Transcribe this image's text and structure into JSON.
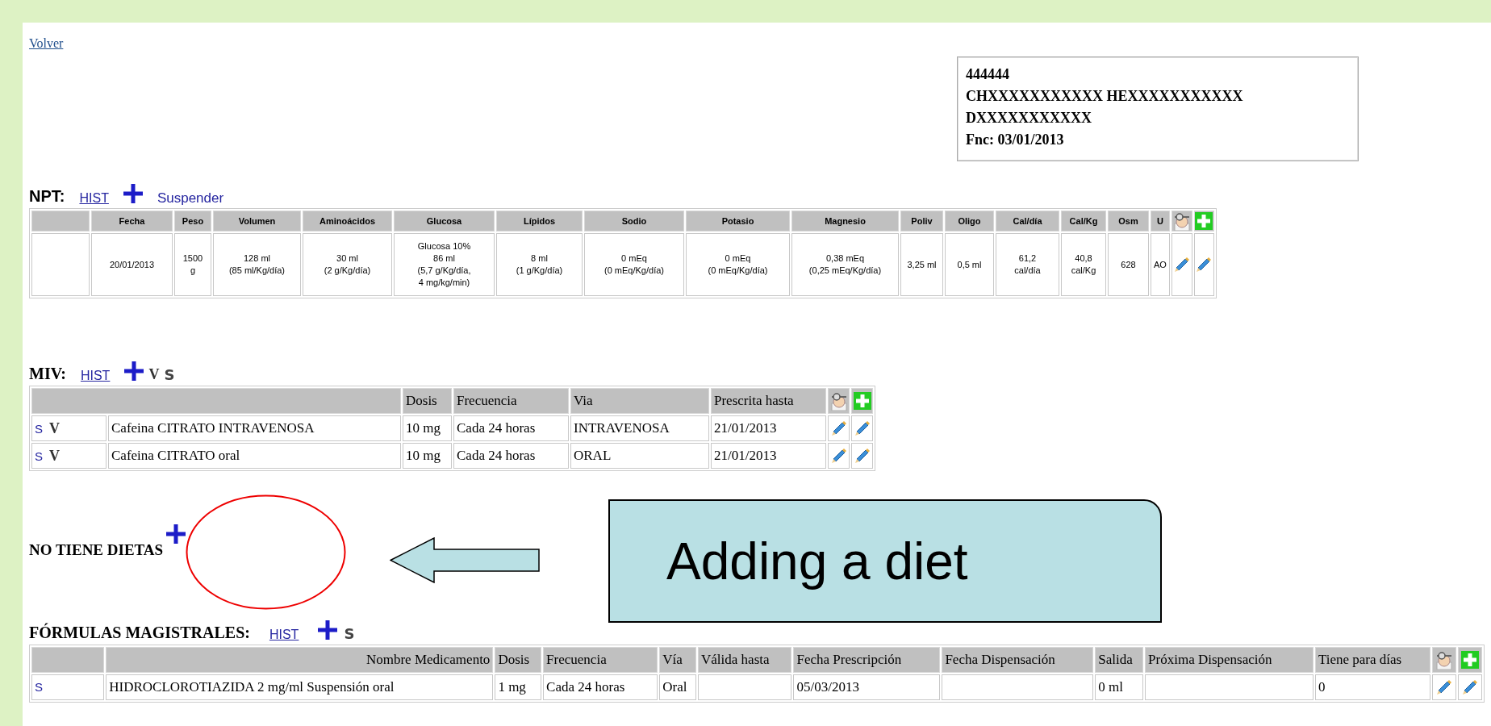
{
  "back_link": "Volver",
  "patient": {
    "lines": [
      "444444",
      "CHXXXXXXXXXXX HEXXXXXXXXXXX",
      "DXXXXXXXXXXX",
      "Fnc: 03/01/2013"
    ]
  },
  "npt": {
    "title": "NPT:",
    "hist": "HIST",
    "suspend": "Suspender",
    "columns": [
      "Fecha",
      "Peso",
      "Volumen",
      "Aminoácidos",
      "Glucosa",
      "Lípidos",
      "Sodio",
      "Potasio",
      "Magnesio",
      "Poliv",
      "Oligo",
      "Cal/día",
      "Cal/Kg",
      "Osm",
      "U"
    ],
    "rows": [
      {
        "cells": [
          "20/01/2013",
          "1500\ng",
          "128 ml\n(85 ml/Kg/día)",
          "30 ml\n(2 g/Kg/día)",
          "Glucosa 10%\n86 ml\n(5,7 g/Kg/día,\n4 mg/kg/min)",
          "8 ml\n(1 g/Kg/día)",
          "0 mEq\n(0 mEq/Kg/día)",
          "0 mEq\n(0 mEq/Kg/día)",
          "0,38 mEq\n(0,25 mEq/Kg/día)",
          "3,25 ml",
          "0,5 ml",
          "61,2\ncal/día",
          "40,8\ncal/Kg",
          "628",
          "AO"
        ]
      }
    ]
  },
  "miv": {
    "title": "MIV:",
    "hist": "HIST",
    "v_action": "V",
    "s_action": "S",
    "columns": [
      "",
      "Dosis",
      "Frecuencia",
      "Via",
      "Prescrita hasta"
    ],
    "rows": [
      {
        "s": "S",
        "v": "V",
        "cells": [
          "Cafeina CITRATO INTRAVENOSA",
          "10 mg",
          "Cada 24 horas",
          "INTRAVENOSA",
          "21/01/2013"
        ]
      },
      {
        "s": "S",
        "v": "V",
        "cells": [
          "Cafeina CITRATO oral",
          "10 mg",
          "Cada 24 horas",
          "ORAL",
          "21/01/2013"
        ]
      }
    ]
  },
  "diets": {
    "title": "NO TIENE DIETAS"
  },
  "formulas": {
    "title": "FÓRMULAS MAGISTRALES:",
    "hist": "HIST",
    "s_action": "S",
    "columns": [
      "Nombre Medicamento",
      "Dosis",
      "Frecuencia",
      "Vía",
      "Válida hasta",
      "Fecha Prescripción",
      "Fecha Dispensación",
      "Salida",
      "Próxima Dispensación",
      "Tiene para días"
    ],
    "rows": [
      {
        "s": "S",
        "cells": [
          "HIDROCLOROTIAZIDA 2 mg/ml Suspensión oral",
          "1 mg",
          "Cada 24 horas",
          "Oral",
          null,
          "05/03/2013",
          null,
          "0 ml",
          null,
          "0"
        ]
      }
    ]
  },
  "annotation": {
    "callout": "Adding a diet"
  }
}
